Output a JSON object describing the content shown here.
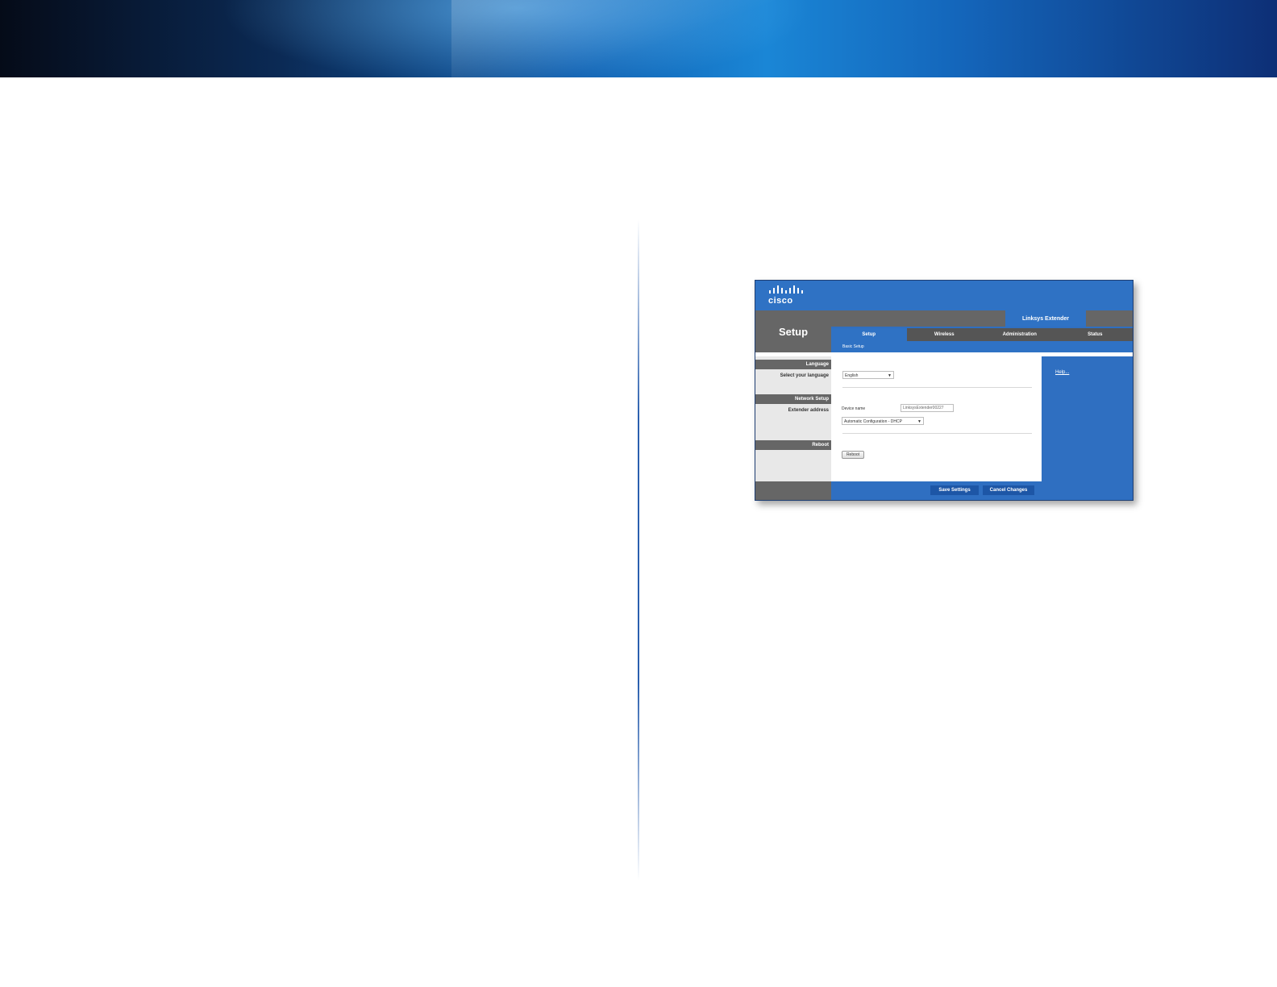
{
  "figure": {
    "logo_text": "cisco",
    "section_title": "Setup",
    "product_name": "Linksys Extender",
    "tabs": [
      {
        "label": "Setup"
      },
      {
        "label": "Wireless"
      },
      {
        "label": "Administration"
      },
      {
        "label": "Status"
      }
    ],
    "subtab": "Basic Setup",
    "left_nav": {
      "language_head": "Language",
      "language_label": "Select your language",
      "network_head": "Network Setup",
      "extender_label": "Extender address",
      "reboot_head": "Reboot"
    },
    "language_select": "English",
    "device_name_label": "Device name",
    "device_name_value": "LinksysExtender00227",
    "address_select": "Automatic Configuration - DHCP",
    "reboot_button": "Reboot",
    "help_link": "Help...",
    "save_button": "Save Settings",
    "cancel_button": "Cancel Changes"
  }
}
